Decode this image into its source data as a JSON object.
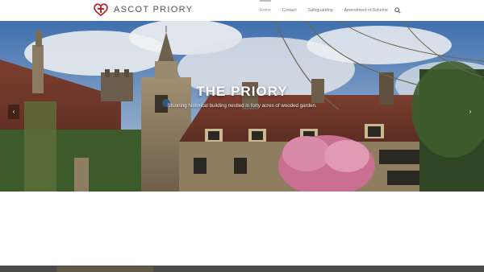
{
  "site": {
    "name": "ASCOT PRIORY",
    "logo_icon": "heart-cross-logo-icon",
    "brand_color": "#c0282e"
  },
  "nav": {
    "items": [
      {
        "label": "Home",
        "active": true
      },
      {
        "label": "Contact",
        "active": false
      },
      {
        "label": "Safeguarding",
        "active": false
      },
      {
        "label": "Amendment of Scheme",
        "active": false
      }
    ],
    "search_icon": "search-icon"
  },
  "hero": {
    "title": "THE PRIORY",
    "subtitle": "Stunning historical building nestled in forty acres of wooded garden.",
    "prev_icon": "chevron-left-icon",
    "next_icon": "chevron-right-icon",
    "prev_glyph": "‹",
    "next_glyph": "›"
  }
}
